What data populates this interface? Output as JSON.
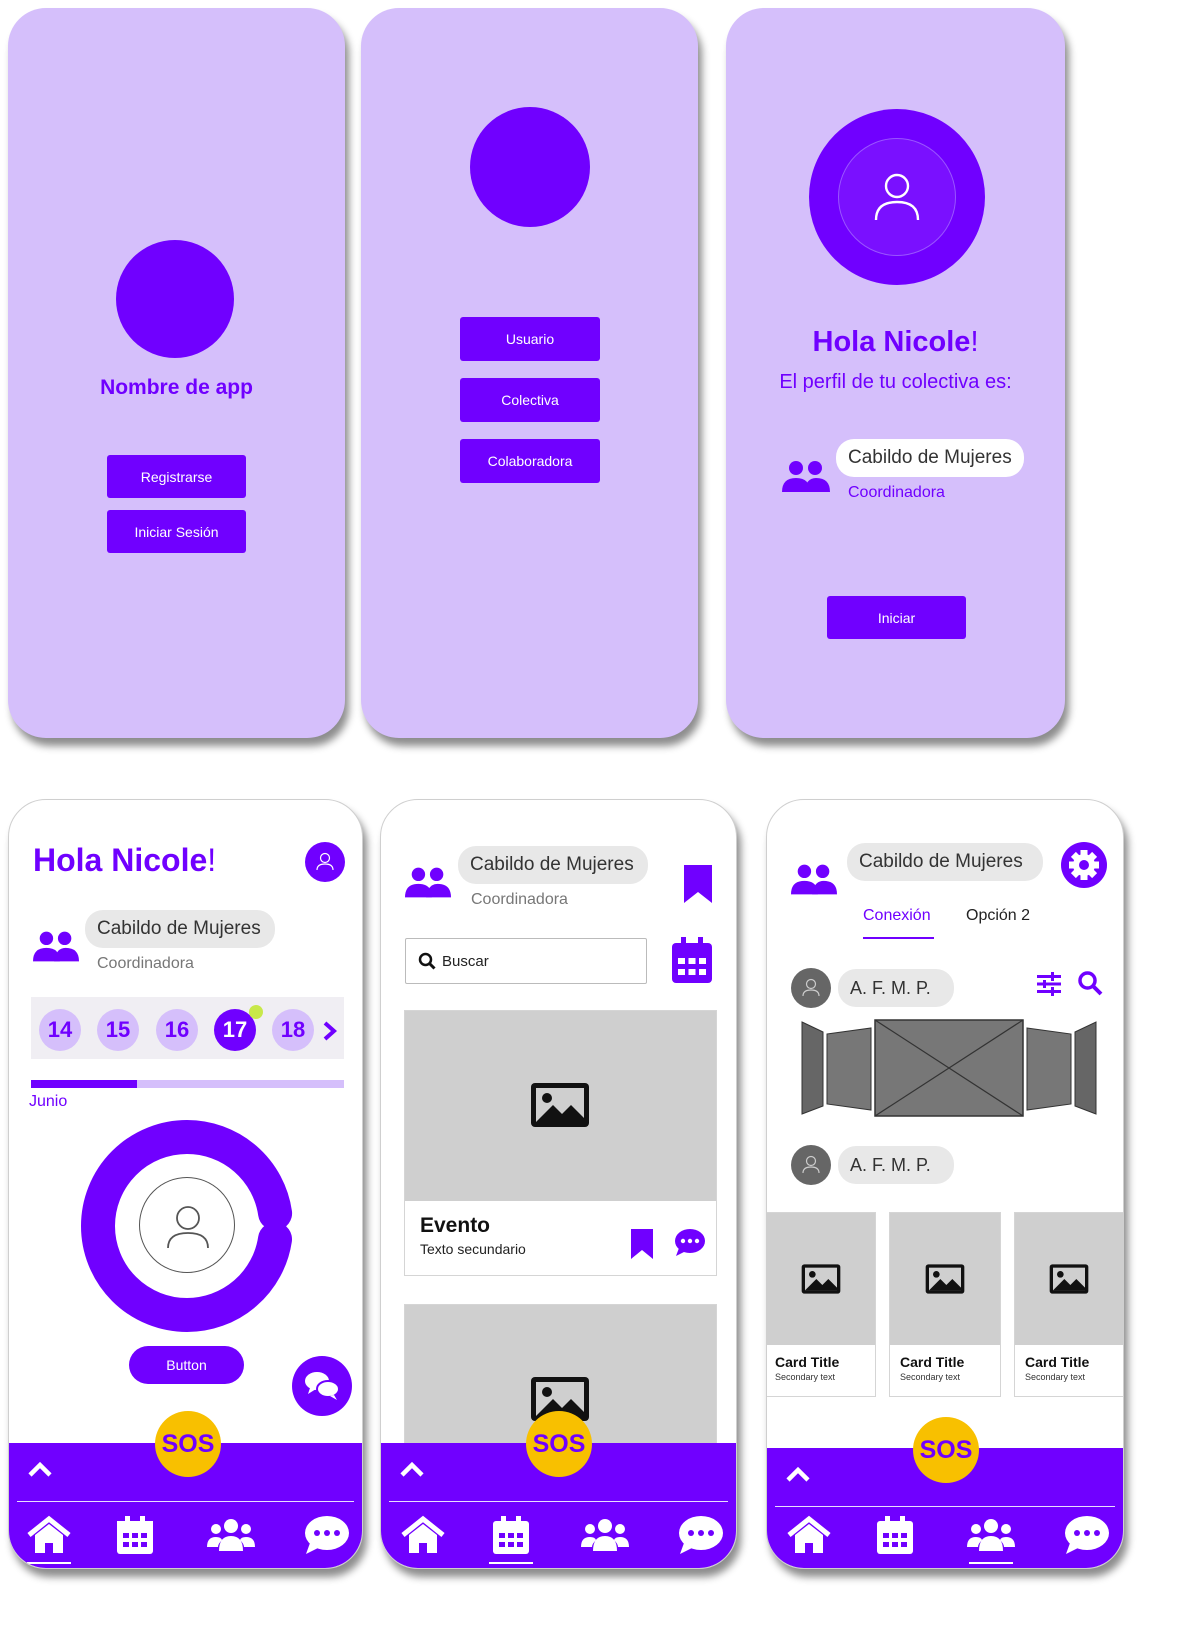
{
  "screen1": {
    "app_name": "Nombre de app",
    "register_label": "Registrarse",
    "login_label": "Iniciar Sesión"
  },
  "screen2": {
    "options": [
      "Usuario",
      "Colectiva",
      "Colaboradora"
    ]
  },
  "screen3": {
    "greeting": "Hola Nicole",
    "greeting_mark": "!",
    "subtitle": "El perfil de tu colectiva es:",
    "collective_name": "Cabildo de Mujeres",
    "role": "Coordinadora",
    "start_label": "Iniciar"
  },
  "home": {
    "greeting": "Hola Nicole",
    "greeting_mark": "!",
    "collective_name": "Cabildo de Mujeres",
    "role": "Coordinadora",
    "days": [
      "14",
      "15",
      "16",
      "17",
      "18"
    ],
    "selected_day": "17",
    "month": "Junio",
    "month_progress": 0.34,
    "button_label": "Button"
  },
  "events": {
    "collective_name": "Cabildo de Mujeres",
    "role": "Coordinadora",
    "search_placeholder": "Buscar",
    "event_title": "Evento",
    "event_subtitle": "Texto secundario"
  },
  "network": {
    "collective_name": "Cabildo de Mujeres",
    "tabs": [
      "Conexión",
      "Opción 2"
    ],
    "active_tab": "Conexión",
    "user1": "A. F. M. P.",
    "user2": "A. F. M. P.",
    "cards": [
      {
        "title": "Card Title",
        "subtitle": "Secondary text"
      },
      {
        "title": "Card Title",
        "subtitle": "Secondary text"
      },
      {
        "title": "Card Title",
        "subtitle": "Secondary text"
      }
    ]
  },
  "bottom_nav": {
    "sos_label": "SOS",
    "items": [
      "home-icon",
      "calendar-icon",
      "people-icon",
      "chat-icon"
    ]
  },
  "colors": {
    "accent": "#7000ff",
    "lilac": "#d5bffb",
    "sos": "#f8c000"
  }
}
